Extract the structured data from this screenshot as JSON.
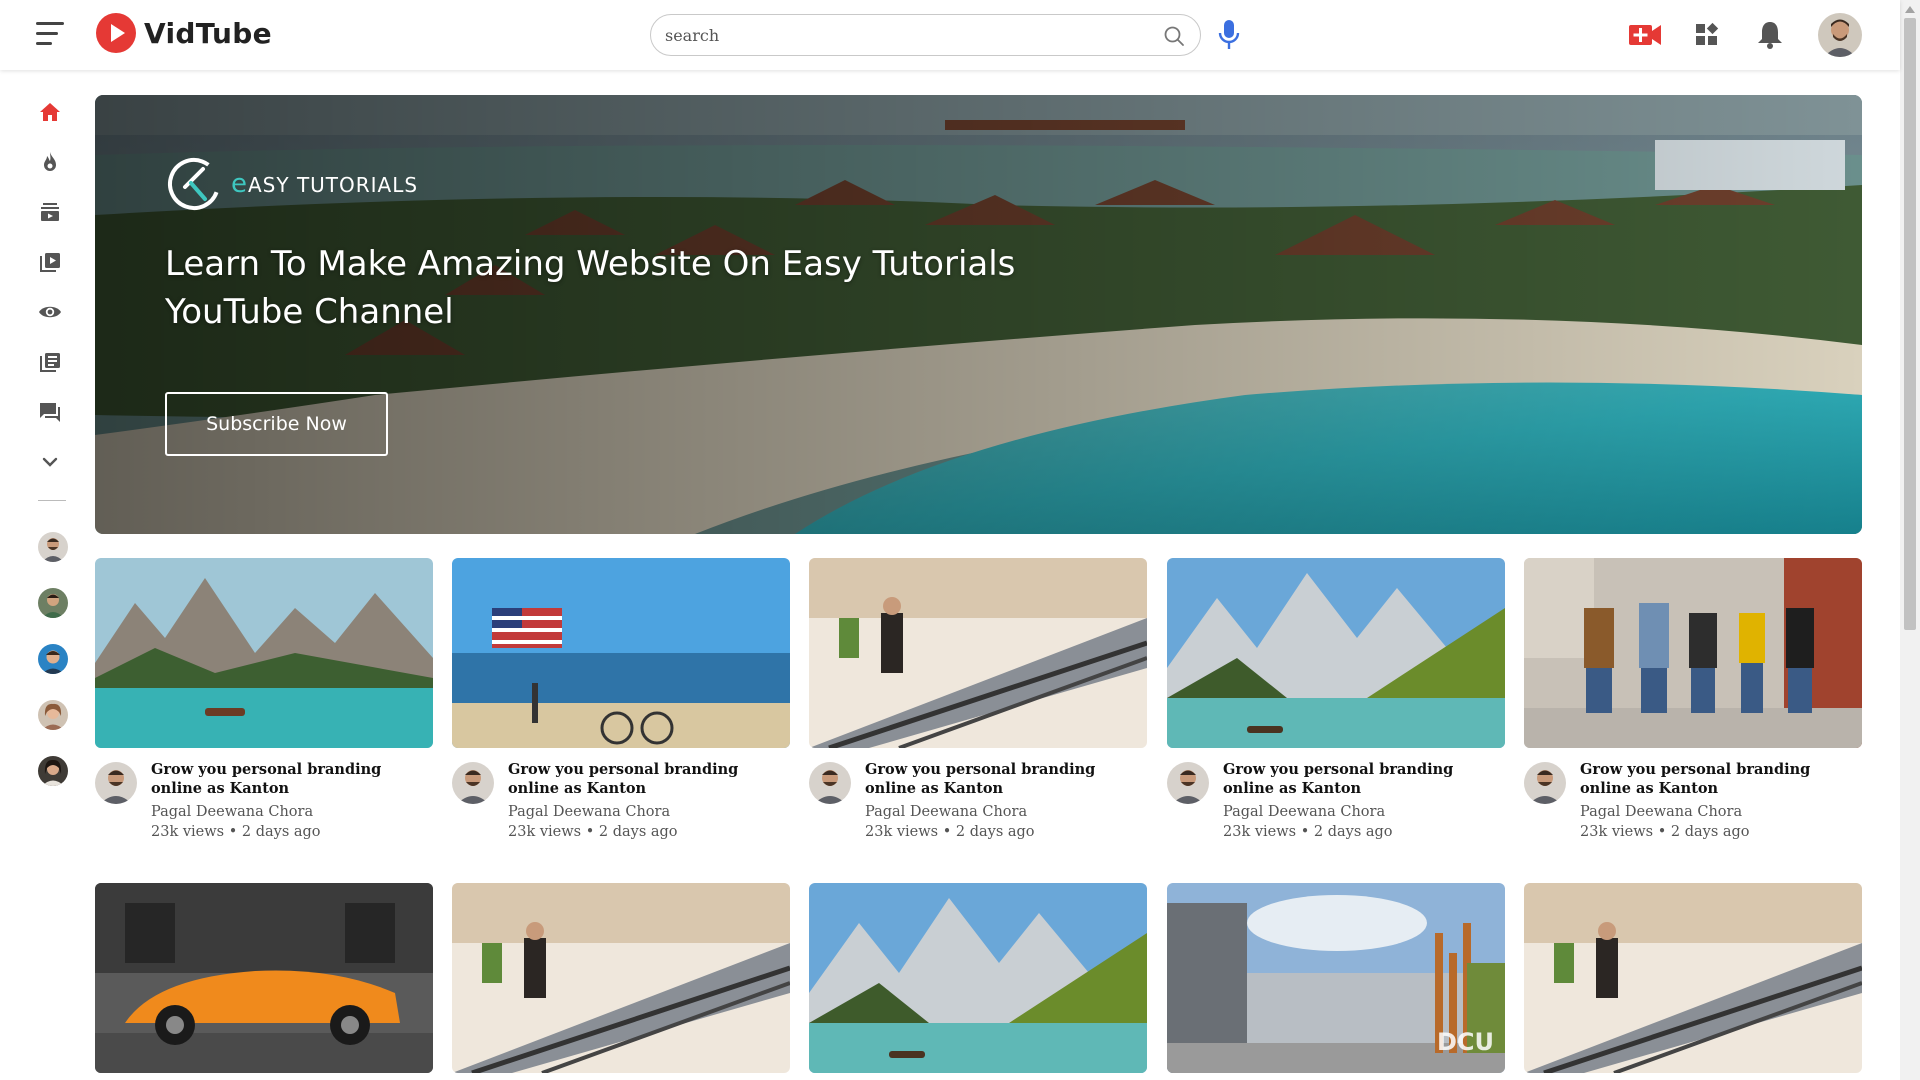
{
  "app": {
    "name": "VidTube",
    "brand_color": "#e53935"
  },
  "search": {
    "placeholder": "search"
  },
  "header_icons": [
    "menu-icon",
    "mic-icon",
    "video-upload-icon",
    "apps-icon",
    "bell-icon"
  ],
  "sidebar": {
    "links": [
      {
        "name": "home",
        "icon": "home-icon",
        "active": true
      },
      {
        "name": "explore",
        "icon": "flame-icon"
      },
      {
        "name": "subscriptions",
        "icon": "subscriptions-icon"
      },
      {
        "name": "library",
        "icon": "playlist-play-icon"
      },
      {
        "name": "history",
        "icon": "eye-icon"
      },
      {
        "name": "playlists",
        "icon": "playlist-icon"
      },
      {
        "name": "messages",
        "icon": "chat-icon"
      },
      {
        "name": "show-more",
        "icon": "chevron-down-icon"
      }
    ],
    "subscriptions": [
      "subscription-avatar-1",
      "subscription-avatar-2",
      "subscription-avatar-3",
      "subscription-avatar-4",
      "subscription-avatar-5"
    ]
  },
  "banner": {
    "brand": "ASY TUTORIALS",
    "brand_prefix": "e",
    "title": "Learn To Make Amazing Website On Easy Tutorials YouTube Channel",
    "cta": "Subscribe Now"
  },
  "videos": [
    {
      "thumbnail": "lake-boat",
      "title": "Grow you personal branding online as Kanton",
      "channel": "Pagal Deewana Chora",
      "meta": "23k views • 2 days ago"
    },
    {
      "thumbnail": "beach-flag",
      "title": "Grow you personal branding online as Kanton",
      "channel": "Pagal Deewana Chora",
      "meta": "23k views • 2 days ago"
    },
    {
      "thumbnail": "escalator",
      "title": "Grow you personal branding online as Kanton",
      "channel": "Pagal Deewana Chora",
      "meta": "23k views • 2 days ago"
    },
    {
      "thumbnail": "mountain-lake",
      "title": "Grow you personal branding online as Kanton",
      "channel": "Pagal Deewana Chora",
      "meta": "23k views • 2 days ago"
    },
    {
      "thumbnail": "friends-walking",
      "title": "Grow you personal branding online as Kanton",
      "channel": "Pagal Deewana Chora",
      "meta": "23k views • 2 days ago"
    },
    {
      "thumbnail": "sports-car",
      "title": "",
      "channel": "",
      "meta": ""
    },
    {
      "thumbnail": "escalator",
      "title": "",
      "channel": "",
      "meta": ""
    },
    {
      "thumbnail": "mountain-lake",
      "title": "",
      "channel": "",
      "meta": ""
    },
    {
      "thumbnail": "university-building",
      "title": "",
      "channel": "",
      "meta": "",
      "overlay_text": "DCU"
    },
    {
      "thumbnail": "escalator",
      "title": "",
      "channel": "",
      "meta": ""
    }
  ]
}
